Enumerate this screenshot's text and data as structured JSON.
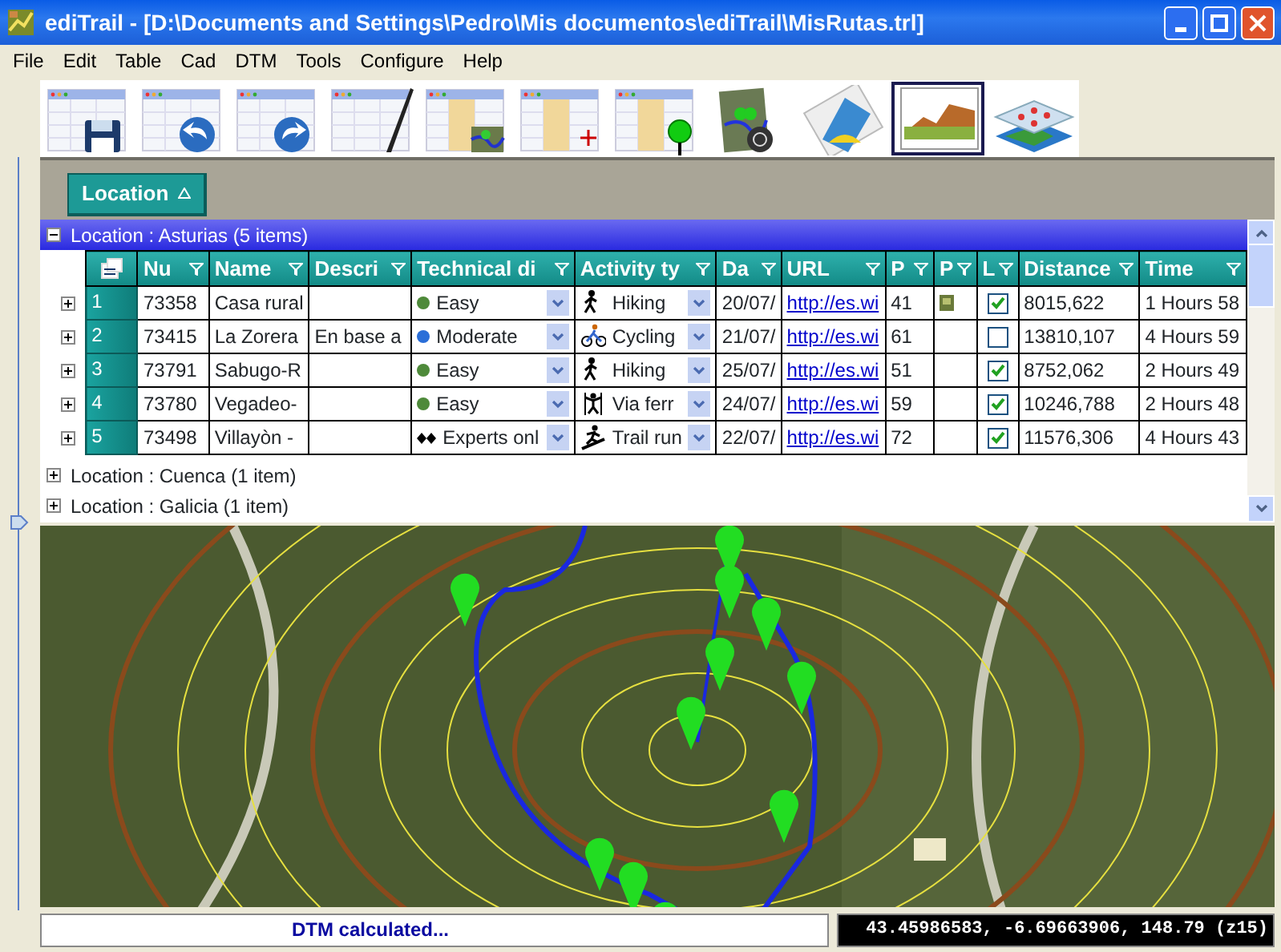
{
  "window": {
    "title": "ediTrail - [D:\\Documents and Settings\\Pedro\\Mis documentos\\ediTrail\\MisRutas.trl]"
  },
  "menu": [
    "File",
    "Edit",
    "Table",
    "Cad",
    "DTM",
    "Tools",
    "Configure",
    "Help"
  ],
  "toolbar": [
    {
      "kind": "save",
      "selected": false
    },
    {
      "kind": "undo",
      "selected": false
    },
    {
      "kind": "redo",
      "selected": false
    },
    {
      "kind": "edit",
      "selected": false
    },
    {
      "kind": "table-map",
      "selected": false
    },
    {
      "kind": "add",
      "selected": false
    },
    {
      "kind": "pin",
      "selected": false
    },
    {
      "kind": "map-camera",
      "selected": false
    },
    {
      "kind": "picture",
      "selected": false
    },
    {
      "kind": "profile",
      "selected": true
    },
    {
      "kind": "layers",
      "selected": false
    }
  ],
  "group_by": {
    "label": "Location"
  },
  "grid": {
    "columns": [
      "Nu",
      "Name",
      "Descri",
      "Technical di",
      "Activity ty",
      "Da",
      "URL",
      "P",
      "P",
      "L",
      "Distance",
      "Time"
    ],
    "groups": [
      {
        "label": "Location : Asturias (5 items)",
        "expanded": true,
        "rows": [
          {
            "index": "1",
            "number": "73358",
            "name": "Casa rural",
            "description": "",
            "technical": {
              "label": "Easy",
              "kind": "dot",
              "color": "#4e8a3a"
            },
            "activity": {
              "label": "Hiking",
              "kind": "hiking"
            },
            "date": "20/07/",
            "url": "http://es.wi",
            "points": "41",
            "photo": true,
            "loaded": true,
            "distance": "8015,622",
            "time": "1 Hours 58"
          },
          {
            "index": "2",
            "number": "73415",
            "name": "La Zorera",
            "description": "En base a",
            "technical": {
              "label": "Moderate",
              "kind": "dot",
              "color": "#2a6ed8"
            },
            "activity": {
              "label": "Cycling",
              "kind": "cycling"
            },
            "date": "21/07/",
            "url": "http://es.wi",
            "points": "61",
            "photo": false,
            "loaded": false,
            "distance": "13810,107",
            "time": "4 Hours 59"
          },
          {
            "index": "3",
            "number": "73791",
            "name": "Sabugo-R",
            "description": "",
            "technical": {
              "label": "Easy",
              "kind": "dot",
              "color": "#4e8a3a"
            },
            "activity": {
              "label": "Hiking",
              "kind": "hiking"
            },
            "date": "25/07/",
            "url": "http://es.wi",
            "points": "51",
            "photo": false,
            "loaded": true,
            "distance": "8752,062",
            "time": "2 Hours 49"
          },
          {
            "index": "4",
            "number": "73780",
            "name": "Vegadeo-",
            "description": "",
            "technical": {
              "label": "Easy",
              "kind": "dot",
              "color": "#4e8a3a"
            },
            "activity": {
              "label": "Via ferr",
              "kind": "via-ferrata"
            },
            "date": "24/07/",
            "url": "http://es.wi",
            "points": "59",
            "photo": false,
            "loaded": true,
            "distance": "10246,788",
            "time": "2 Hours 48"
          },
          {
            "index": "5",
            "number": "73498",
            "name": "Villayòn -",
            "description": "",
            "technical": {
              "label": "Experts onl",
              "kind": "diamonds"
            },
            "activity": {
              "label": "Trail run",
              "kind": "trail-run"
            },
            "date": "22/07/",
            "url": "http://es.wi",
            "points": "72",
            "photo": false,
            "loaded": true,
            "distance": "11576,306",
            "time": "4 Hours 43"
          }
        ]
      },
      {
        "label": "Location : Cuenca (1 item)",
        "expanded": false
      },
      {
        "label": "Location : Galicia (1 item)",
        "expanded": false
      }
    ]
  },
  "status_bar": {
    "message": "DTM calculated...",
    "coordinates": "43.45986583, -6.69663906, 148.79 (z15)"
  }
}
